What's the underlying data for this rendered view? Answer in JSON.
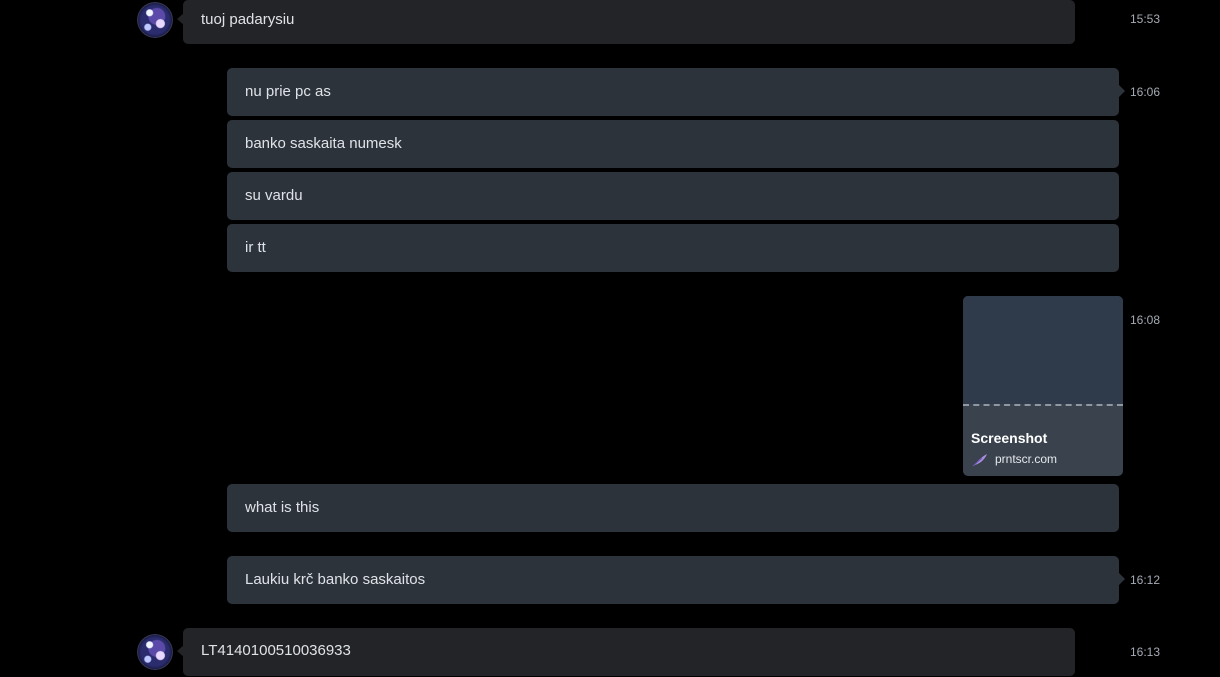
{
  "messages": [
    {
      "sender": "contact",
      "text": "tuoj padarysiu",
      "time": "15:53"
    },
    {
      "sender": "me",
      "text": "nu prie pc as",
      "time": "16:06"
    },
    {
      "sender": "me",
      "text": "banko saskaita numesk"
    },
    {
      "sender": "me",
      "text": "su vardu"
    },
    {
      "sender": "me",
      "text": "ir tt"
    },
    {
      "sender": "me",
      "type": "link-preview",
      "title": "Screenshot",
      "source": "prntscr.com",
      "time": "16:08"
    },
    {
      "sender": "me",
      "text": "what is this"
    },
    {
      "sender": "me",
      "text": "Laukiu krč banko saskaitos",
      "time": "16:12"
    },
    {
      "sender": "contact",
      "text": "LT4140100510036933",
      "time": "16:13"
    }
  ],
  "icons": {
    "avatar": "globe-avatar",
    "link_source": "feather-icon"
  }
}
